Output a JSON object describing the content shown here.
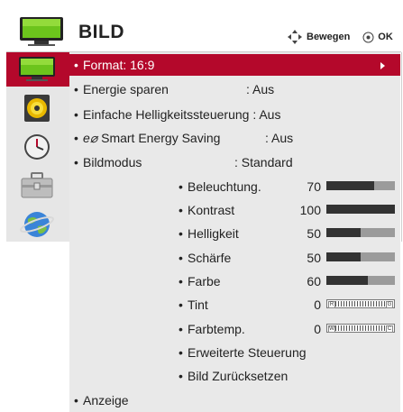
{
  "header": {
    "title": "BILD",
    "move_label": "Bewegen",
    "ok_label": "OK"
  },
  "rail": [
    {
      "icon": "picture-tv-icon",
      "selected": true
    },
    {
      "icon": "audio-speaker-icon",
      "selected": false
    },
    {
      "icon": "clock-icon",
      "selected": false
    },
    {
      "icon": "options-toolbox-icon",
      "selected": false
    },
    {
      "icon": "network-globe-icon",
      "selected": false
    }
  ],
  "menu": {
    "format": {
      "label": "Format: 16:9"
    },
    "energy": {
      "label": "Energie sparen",
      "value": ": Aus"
    },
    "brightness_control": {
      "label": "Einfache Helligkeitssteuerung : Aus"
    },
    "smart_energy": {
      "prefix": "e⌀",
      "label": "Smart Energy Saving",
      "value": ": Aus"
    },
    "picture_mode": {
      "label": "Bildmodus",
      "value": ": Standard"
    },
    "settings": [
      {
        "label": "Beleuchtung.",
        "value": "70",
        "level": 70
      },
      {
        "label": "Kontrast",
        "value": "100",
        "level": 100
      },
      {
        "label": "Helligkeit",
        "value": "50",
        "level": 50
      },
      {
        "label": "Schärfe",
        "value": "50",
        "level": 50
      },
      {
        "label": "Farbe",
        "value": "60",
        "level": 60
      }
    ],
    "tint": {
      "label": "Tint",
      "value": "0",
      "left": "R",
      "right": "G"
    },
    "color_temp": {
      "label": "Farbtemp.",
      "value": "0",
      "left": "W",
      "right": "C"
    },
    "advanced": {
      "label": "Erweiterte Steuerung"
    },
    "reset": {
      "label": "Bild Zurücksetzen"
    },
    "display": {
      "label": "Anzeige"
    }
  },
  "colors": {
    "accent": "#b4082b",
    "panel": "#e9e9e9",
    "bar_fill": "#333333",
    "bar_track": "#9b9b9b"
  }
}
